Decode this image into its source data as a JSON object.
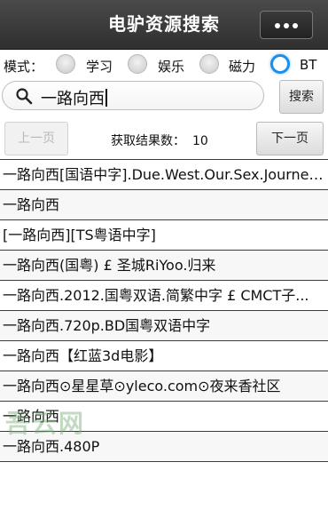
{
  "app": {
    "title": "电驴资源搜索"
  },
  "mode": {
    "label": "模式：",
    "options": [
      {
        "label": "学习",
        "selected": false
      },
      {
        "label": "娱乐",
        "selected": false
      },
      {
        "label": "磁力",
        "selected": false
      },
      {
        "label": "BT",
        "selected": true
      }
    ]
  },
  "search": {
    "value": "一路向西",
    "button": "搜索"
  },
  "pager": {
    "prev": "上一页",
    "next": "下一页",
    "result_label": "获取结果数：",
    "result_count": "10"
  },
  "results": [
    "一路向西[国语中字].Due.West.Our.Sex.Journey...",
    "一路向西",
    "[一路向西][TS粤语中字]",
    "一路向西(国粤) £ 圣城RiYoo.归来",
    "一路向西.2012.国粤双语.简繁中字 £ CMCT子...",
    "一路向西.720p.BD国粤双语中字",
    "一路向西【红蓝3d电影】",
    "一路向西⊙星星草⊙yleco.com⊙夜来香社区",
    "一路向西",
    "一路向西.480P"
  ],
  "watermark": "吾云网",
  "colors": {
    "titlebar": "#3a3a3a",
    "radio_accent": "#1e8fe8"
  }
}
